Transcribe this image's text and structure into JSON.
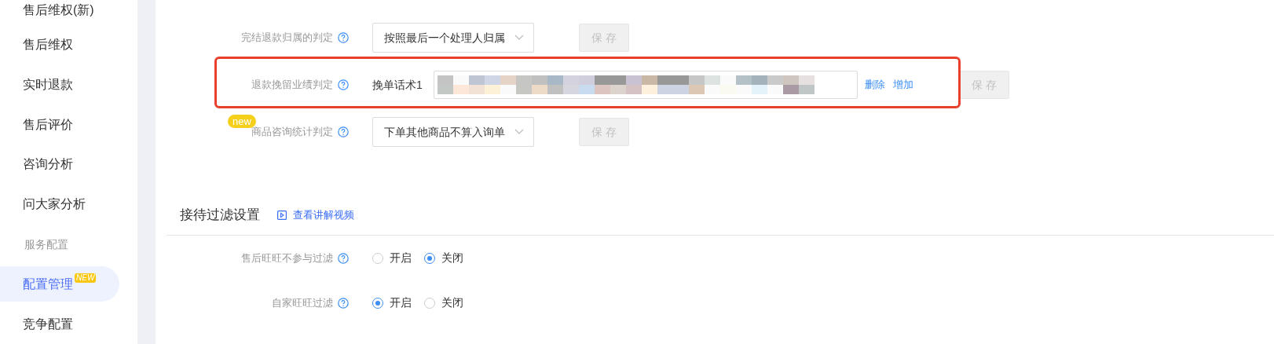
{
  "sidebar": {
    "items": [
      {
        "kind": "item",
        "label": "售后维权(新)",
        "selected": false
      },
      {
        "kind": "item",
        "label": "售后维权",
        "selected": false
      },
      {
        "kind": "item",
        "label": "实时退款",
        "selected": false
      },
      {
        "kind": "item",
        "label": "售后评价",
        "selected": false
      },
      {
        "kind": "item",
        "label": "咨询分析",
        "selected": false
      },
      {
        "kind": "item",
        "label": "问大家分析",
        "selected": false
      },
      {
        "kind": "group",
        "label": "服务配置"
      },
      {
        "kind": "item",
        "label": "配置管理",
        "selected": true,
        "badge": "NEW"
      },
      {
        "kind": "item",
        "label": "竞争配置",
        "selected": false
      }
    ]
  },
  "judgement_settings": [
    {
      "kind": "select",
      "label": "完结退款归属的判定",
      "value": "按照最后一个处理人归属",
      "save": "保 存",
      "save_disabled": true
    },
    {
      "kind": "text_list",
      "label": "退款挽留业绩判定",
      "highlighted": true,
      "item_label": "挽单话术1",
      "actions": [
        "删除",
        "增加"
      ],
      "save": "保 存",
      "save_disabled": true
    },
    {
      "kind": "select",
      "label": "商品咨询统计判定",
      "badge": "new",
      "value": "下单其他商品不算入询单",
      "save": "保 存",
      "save_disabled": true
    }
  ],
  "filter_section": {
    "title": "接待过滤设置",
    "video_link": "查看讲解视频",
    "rows": [
      {
        "label": "售后旺旺不参与过滤",
        "options": [
          {
            "label": "开启",
            "selected": false
          },
          {
            "label": "关闭",
            "selected": true
          }
        ]
      },
      {
        "label": "自家旺旺过滤",
        "options": [
          {
            "label": "开启",
            "selected": true
          },
          {
            "label": "关闭",
            "selected": false
          }
        ]
      }
    ]
  }
}
